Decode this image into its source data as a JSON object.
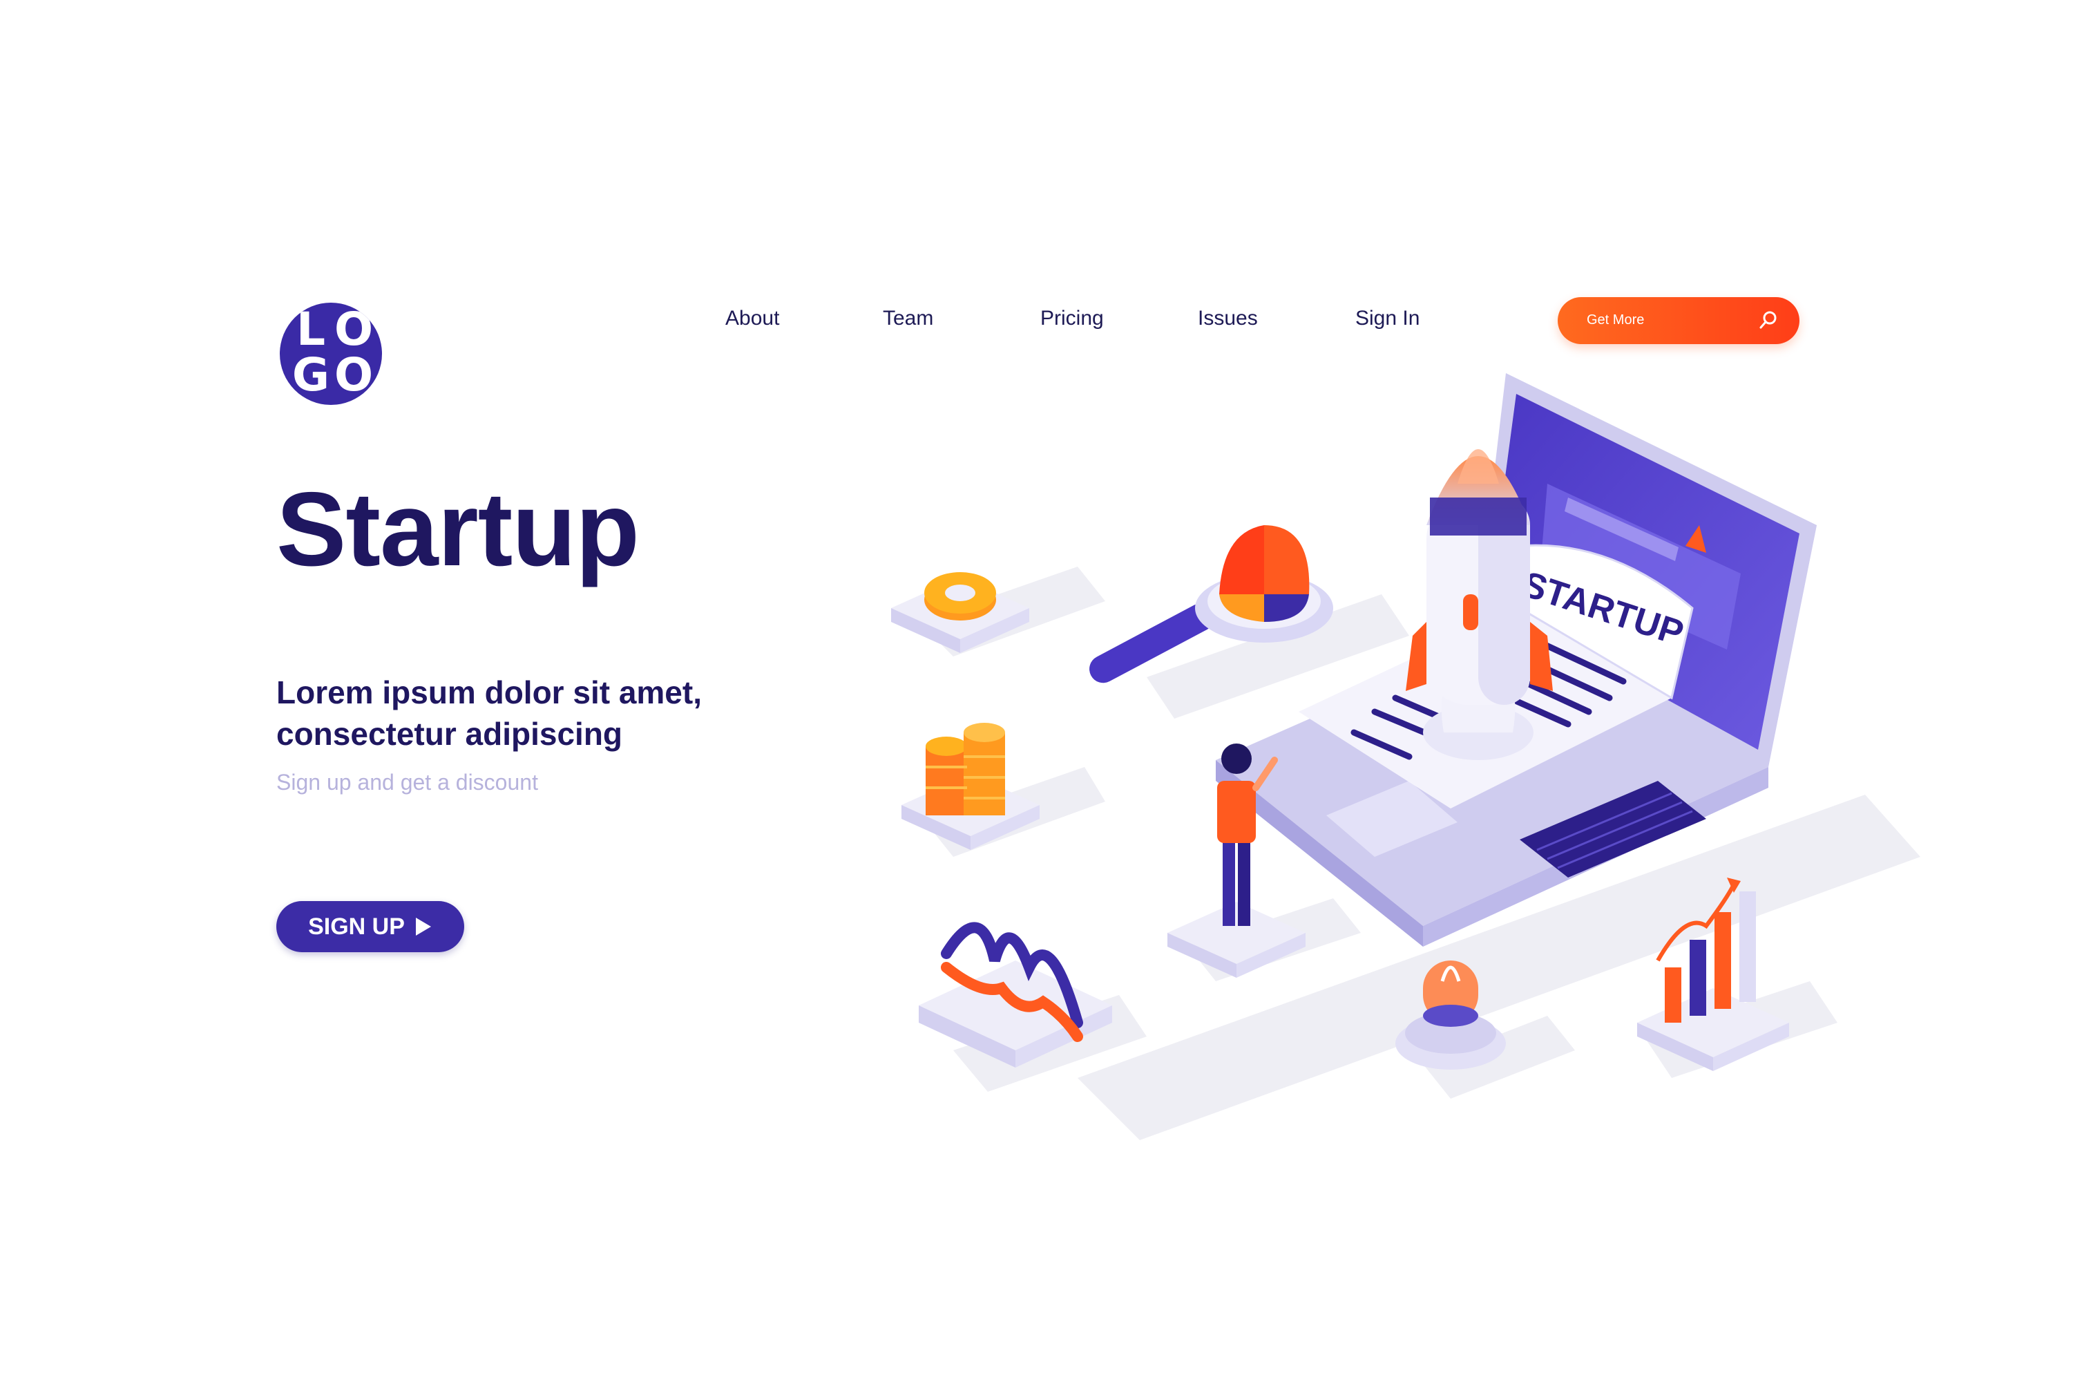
{
  "logo": {
    "letters": [
      "L",
      "O",
      "G",
      "O"
    ]
  },
  "nav": {
    "items": [
      {
        "label": "About"
      },
      {
        "label": "Team"
      },
      {
        "label": "Pricing"
      },
      {
        "label": "Issues"
      },
      {
        "label": "Sign In"
      }
    ]
  },
  "cta": {
    "label": "Get More",
    "icon": "search-icon"
  },
  "hero": {
    "title": "Startup",
    "subtitle": "Lorem ipsum dolor sit amet, consectetur adipiscing",
    "note": "Sign up and get a discount",
    "signup_label": "SIGN UP",
    "signup_icon": "play-arrow-icon"
  },
  "illustration": {
    "document_text": "STARTUP"
  },
  "colors": {
    "primary": "#3c2ca6",
    "dark_text": "#1f1760",
    "accent": "#ff5a1f",
    "muted": "#b6b2dc",
    "lavender": "#d9d7f5"
  }
}
